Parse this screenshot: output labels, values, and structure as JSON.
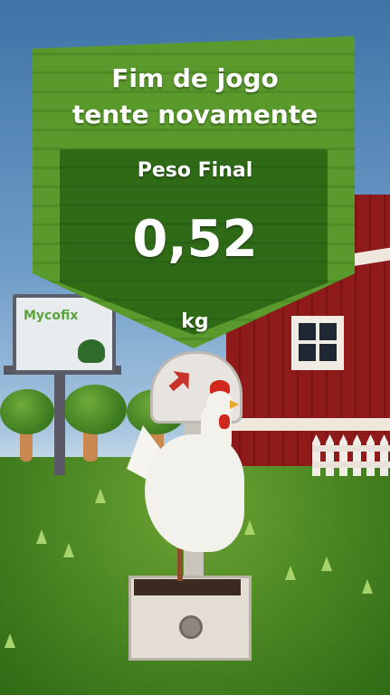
{
  "game_over": {
    "title_line1": "Fim de jogo",
    "title_line2": "tente novamente",
    "final_weight_label": "Peso Final",
    "final_weight_value": "0,52",
    "weight_unit": "kg"
  },
  "billboard": {
    "brand_text": "Mycofix"
  },
  "colors": {
    "banner_green": "#5a9a2c",
    "banner_dark_green": "#2f6b17",
    "barn_red": "#8e1a1a",
    "text_white": "#ffffff"
  }
}
